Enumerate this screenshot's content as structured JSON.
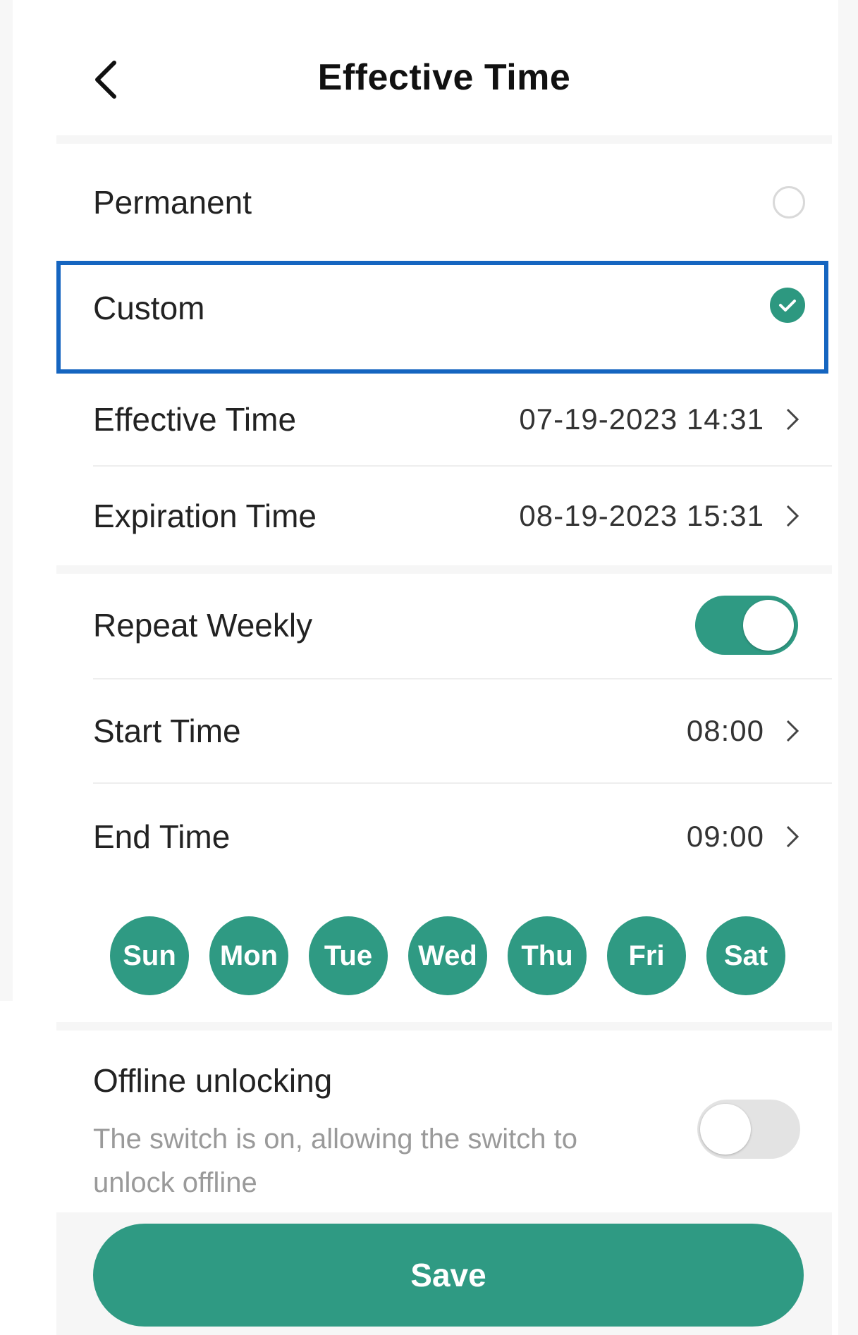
{
  "header": {
    "title": "Effective Time",
    "back_icon": "chevron-left-icon"
  },
  "options": {
    "permanent_label": "Permanent",
    "permanent_selected": false,
    "custom_label": "Custom",
    "custom_selected": true
  },
  "custom": {
    "effective_time_label": "Effective Time",
    "effective_time_value": "07-19-2023 14:31",
    "expiration_time_label": "Expiration Time",
    "expiration_time_value": "08-19-2023 15:31"
  },
  "repeat": {
    "label": "Repeat Weekly",
    "enabled": true,
    "start_time_label": "Start Time",
    "start_time_value": "08:00",
    "end_time_label": "End Time",
    "end_time_value": "09:00",
    "days": [
      "Sun",
      "Mon",
      "Tue",
      "Wed",
      "Thu",
      "Fri",
      "Sat"
    ]
  },
  "offline": {
    "title": "Offline unlocking",
    "description": "The switch is on, allowing the switch to unlock offline",
    "enabled": false
  },
  "save_label": "Save",
  "colors": {
    "accent": "#2f9a83",
    "selection_outline": "#1565c0"
  }
}
